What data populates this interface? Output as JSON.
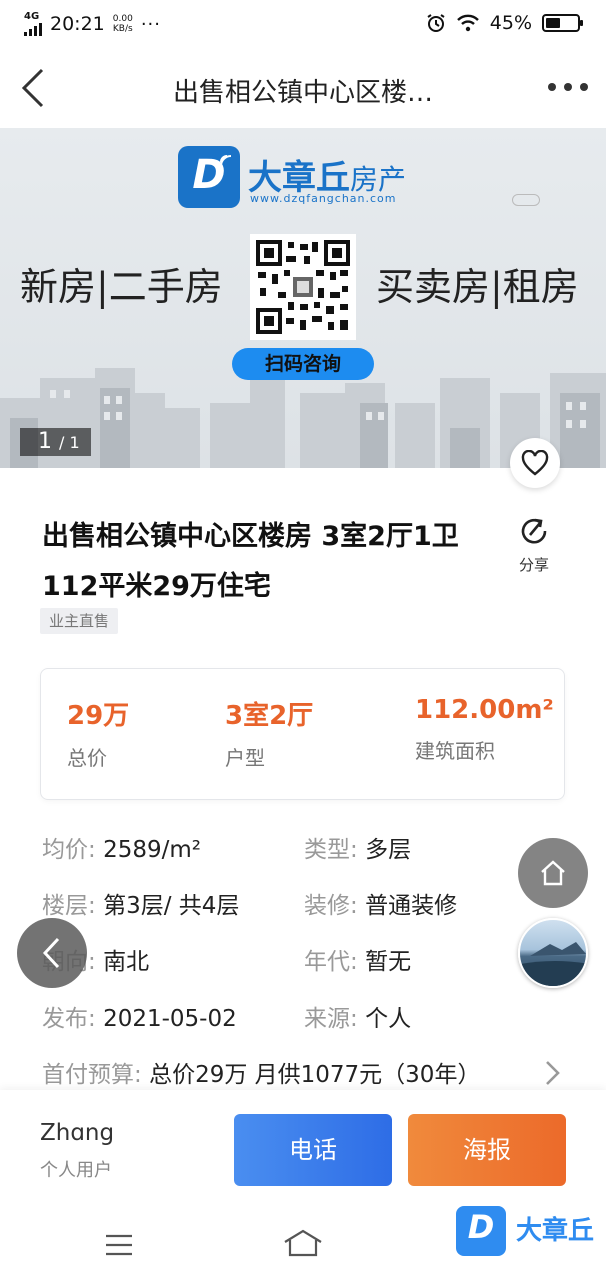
{
  "status_bar": {
    "network": "4G",
    "time": "20:21",
    "speed_value": "0.00",
    "speed_unit": "KB/s",
    "more": "···",
    "battery": "45%",
    "battery_level": 0.45
  },
  "nav": {
    "title": "出售相公镇中心区楼…",
    "back_icon": "chevron-left-icon",
    "more_icon": "more-dots-icon"
  },
  "banner": {
    "logo_letter": "D",
    "logo_name": "大章丘",
    "logo_suffix": "房产",
    "logo_url": "www.dzqfangchan.com",
    "left_text": "新房|二手房",
    "right_text": "买卖房|租房",
    "qr_button": "扫码咨询",
    "counter_current": "1",
    "counter_total": "/ 1"
  },
  "listing": {
    "title": "出售相公镇中心区楼房 3室2厅1卫112平米29万住宅",
    "share_label": "分享",
    "tag": "业主直售"
  },
  "stats": [
    {
      "value": "29万",
      "label": "总价"
    },
    {
      "value": "3室2厅",
      "label": "户型"
    },
    {
      "value": "112.00m²",
      "label": "建筑面积"
    }
  ],
  "info": {
    "unit_price_key": "均价:",
    "unit_price_val": "2589/m²",
    "type_key": "类型:",
    "type_val": "多层",
    "floor_key": "楼层:",
    "floor_val": "第3层/ 共4层",
    "decor_key": "装修:",
    "decor_val": "普通装修",
    "orient_key": "朝向:",
    "orient_val": "南北",
    "year_key": "年代:",
    "year_val": "暂无",
    "publish_key": "发布:",
    "publish_val": "2021-05-02",
    "source_key": "来源:",
    "source_val": "个人",
    "down_key": "首付预算:",
    "down_val": "总价29万 月供1077元（30年）"
  },
  "contact": {
    "name": "Zhɑng",
    "role": "个人用户",
    "phone_button": "电话",
    "poster_button": "海报"
  },
  "watermark": {
    "letter": "D",
    "name": "大章丘"
  },
  "colors": {
    "accent_orange": "#e8632b",
    "phone_blue": "#2e6de6",
    "poster_orange": "#ec6a2a",
    "brand_blue": "#1a73c8"
  }
}
